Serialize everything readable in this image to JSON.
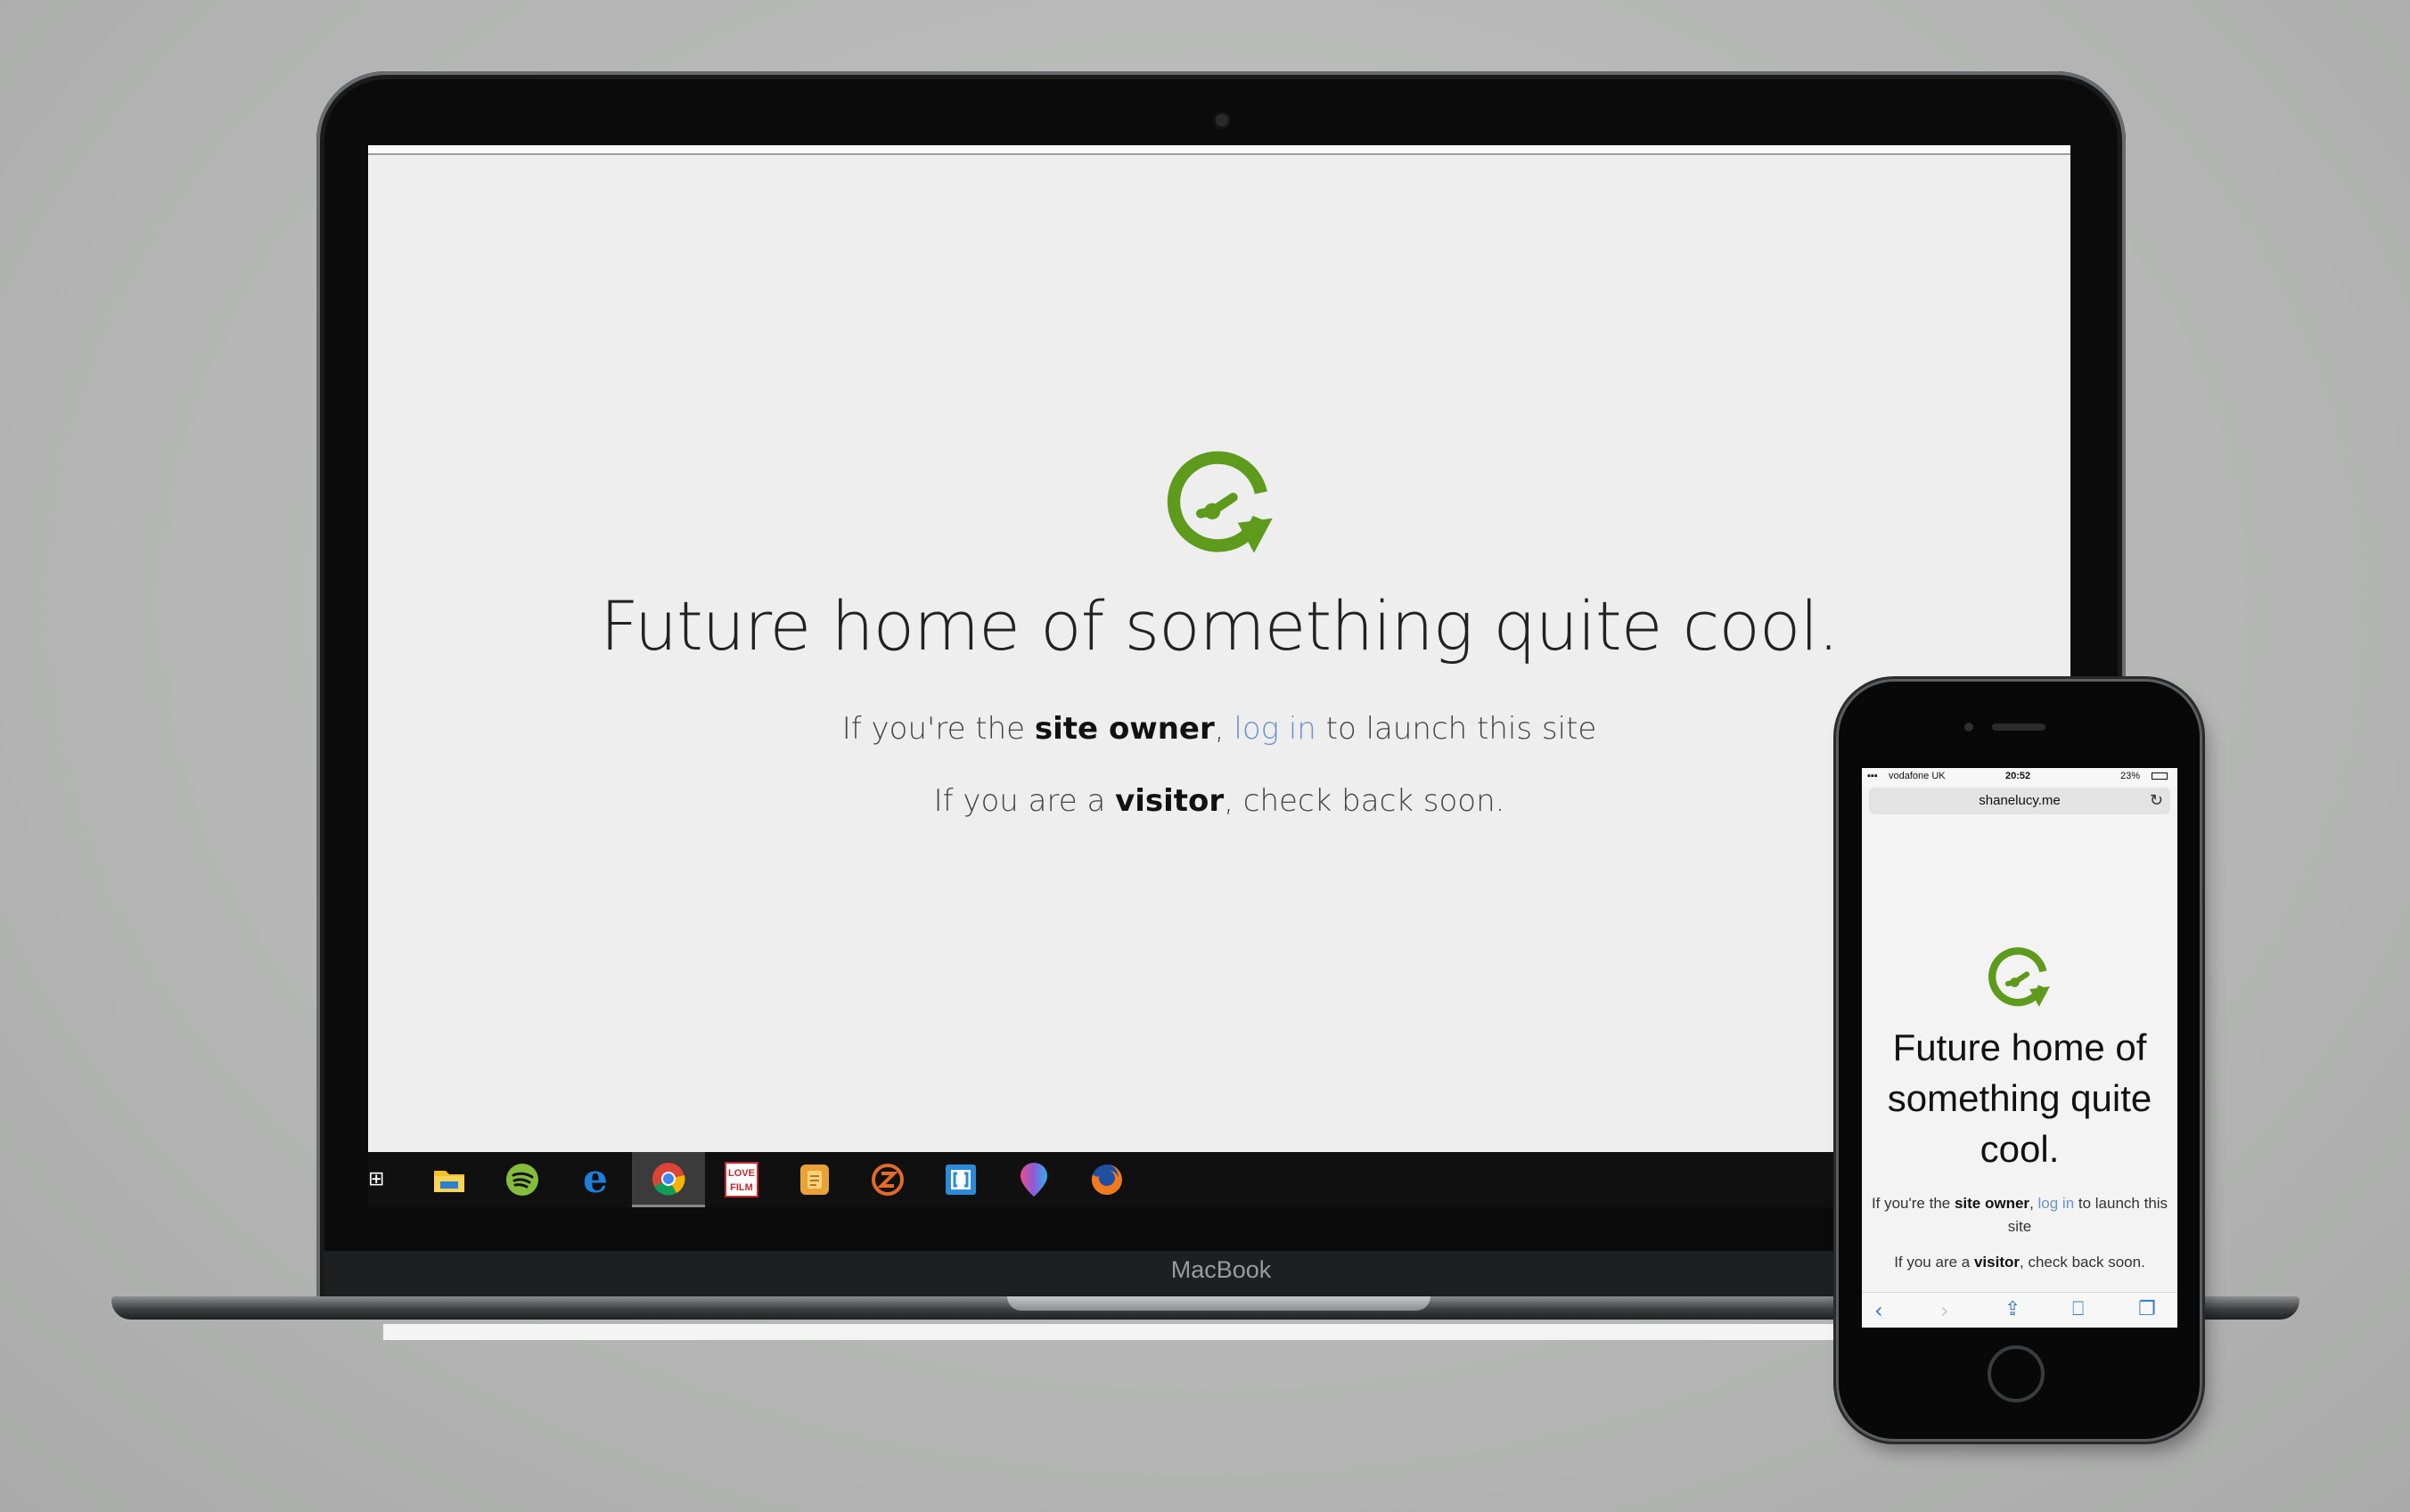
{
  "laptop": {
    "brand_label": "MacBook",
    "page": {
      "headline": "Future home of something quite cool.",
      "owner_line": {
        "prefix": "If you're the ",
        "bold": "site owner",
        "comma": ", ",
        "link": "log in",
        "suffix": " to launch this site"
      },
      "visitor_line": {
        "prefix": "If you are a ",
        "bold": "visitor",
        "suffix": ", check back soon."
      }
    },
    "taskbar": {
      "items": [
        "start",
        "file-explorer-icon",
        "spotify-icon",
        "edge-icon",
        "chrome-icon",
        "lovefilm-icon",
        "notes-app-icon",
        "z-app-icon",
        "bracket-app-icon",
        "maps-pin-icon",
        "firefox-icon"
      ],
      "active": "chrome-icon",
      "lovefilm_text": "LOVE FILM"
    }
  },
  "phone": {
    "status": {
      "carrier": "vodafone UK",
      "time": "20:52",
      "battery": "23%"
    },
    "address": "shanelucy.me",
    "page": {
      "headline": "Future home of something quite cool.",
      "owner_line": {
        "prefix": "If you're the ",
        "bold": "site owner",
        "comma": ", ",
        "link": "log in",
        "suffix": " to launch this site"
      },
      "visitor_line": {
        "prefix": "If you are a ",
        "bold": "visitor",
        "suffix": ", check back soon."
      }
    },
    "toolbar": [
      "back-icon",
      "forward-icon",
      "share-icon",
      "bookmarks-icon",
      "tabs-icon"
    ]
  },
  "colors": {
    "logo_green": "#5e9a1c",
    "link_blue": "#6a93c7",
    "ios_blue": "#3478c6"
  }
}
